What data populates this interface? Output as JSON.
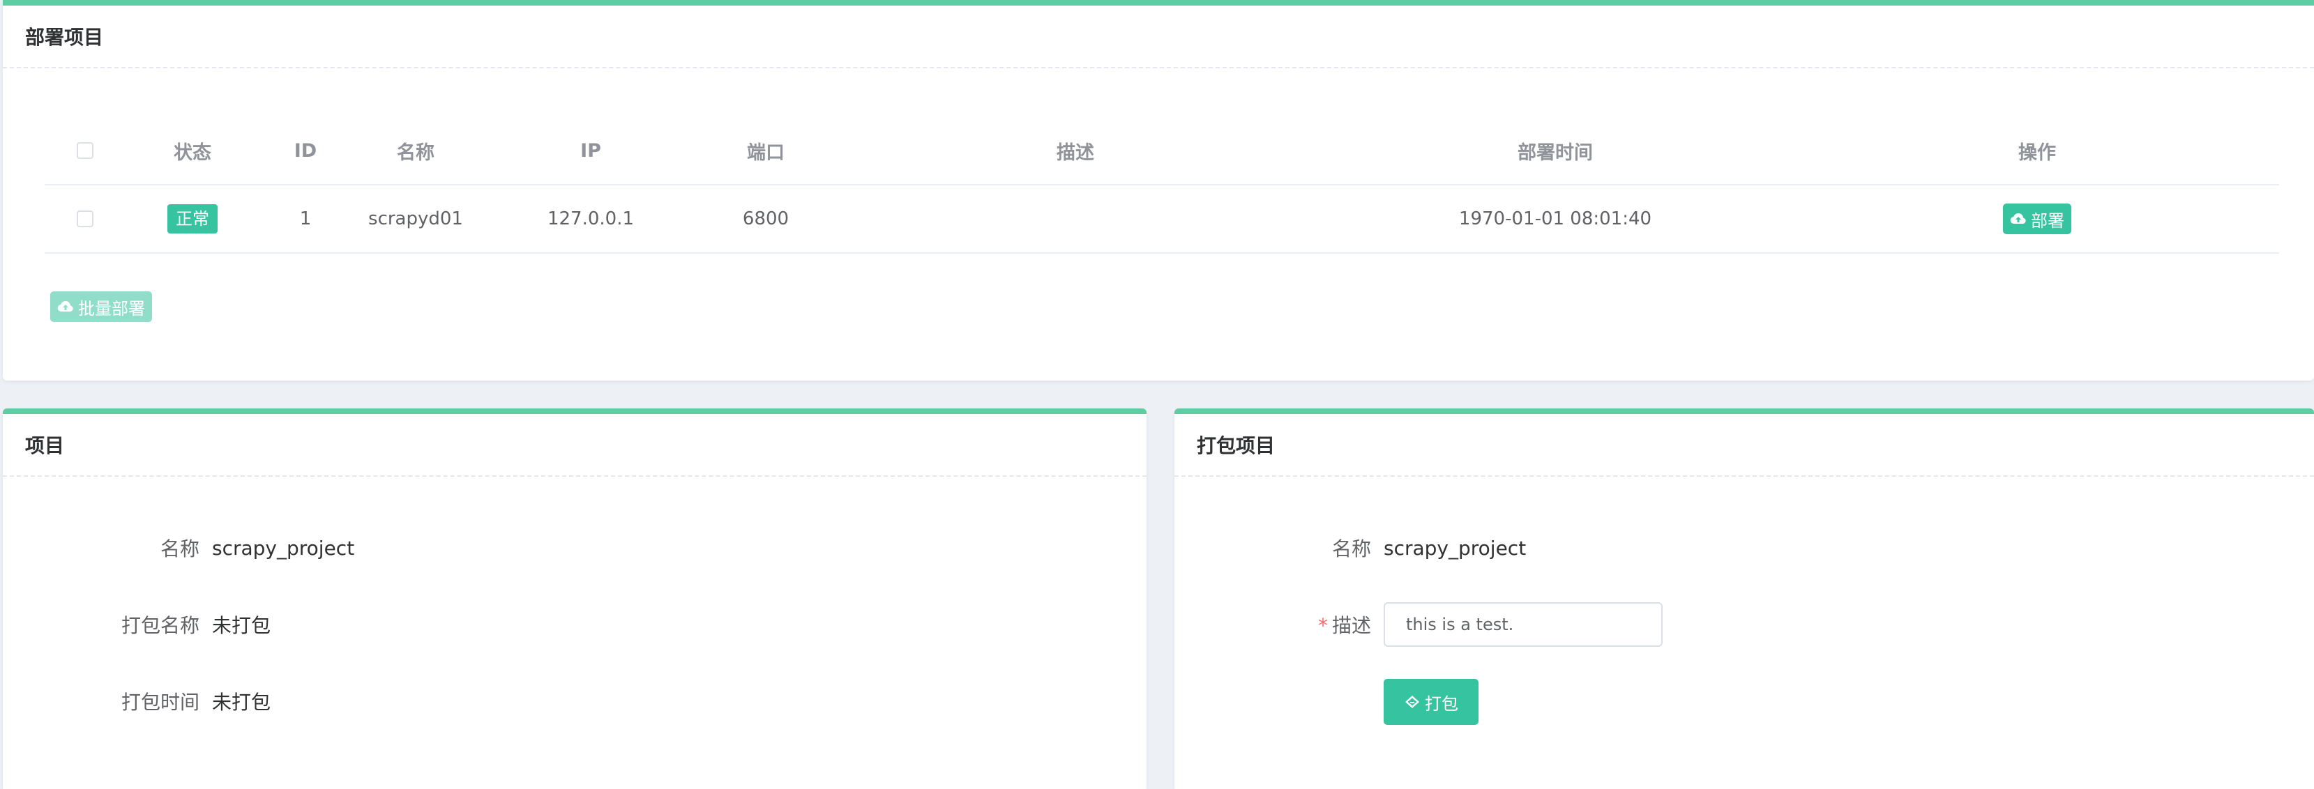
{
  "deploy": {
    "title": "部署项目",
    "columns": {
      "status": "状态",
      "id": "ID",
      "name": "名称",
      "ip": "IP",
      "port": "端口",
      "desc": "描述",
      "time": "部署时间",
      "op": "操作"
    },
    "rows": [
      {
        "status": "正常",
        "id": "1",
        "name": "scrapyd01",
        "ip": "127.0.0.1",
        "port": "6800",
        "desc": "",
        "time": "1970-01-01 08:01:40",
        "action": "部署"
      }
    ],
    "batch_label": "批量部署"
  },
  "project": {
    "title": "项目",
    "name_label": "名称",
    "name_value": "scrapy_project",
    "pkg_name_label": "打包名称",
    "pkg_name_value": "未打包",
    "pkg_time_label": "打包时间",
    "pkg_time_value": "未打包"
  },
  "package": {
    "title": "打包项目",
    "name_label": "名称",
    "name_value": "scrapy_project",
    "required_mark": "*",
    "desc_label": "描述",
    "desc_value": "this is a test.",
    "button_label": "打包"
  },
  "colors": {
    "accent": "#36c3a0",
    "card_border": "#5fcda4",
    "background": "#edf0f4"
  },
  "icons": {
    "deploy": "cloud-upload-icon",
    "package": "package-icon"
  }
}
